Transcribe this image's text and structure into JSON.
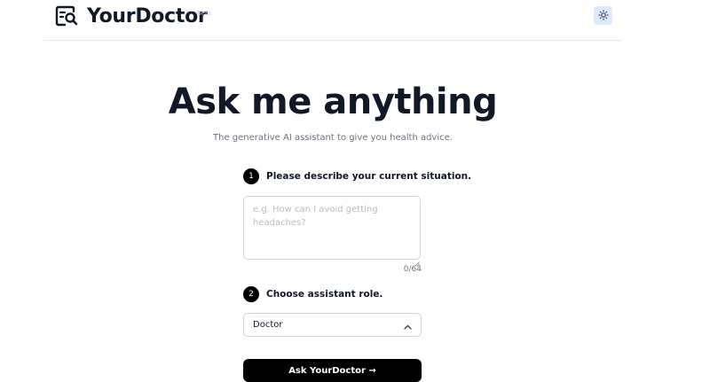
{
  "header": {
    "brand": "YourDoctor",
    "badge": "Beta",
    "logo_icon": "document-search-icon",
    "theme_icon": "sun-icon",
    "theme_button_color": "#dbeafe"
  },
  "hero": {
    "title": "Ask me anything",
    "subtitle": "The generative AI assistant to give you health advice."
  },
  "form": {
    "step1": {
      "number": "1",
      "label": "Please describe your current situation."
    },
    "situation": {
      "value": "",
      "placeholder": "e.g. How can I avoid getting headaches?",
      "counter": "0/64"
    },
    "step2": {
      "number": "2",
      "label": "Choose assistant role."
    },
    "role_select": {
      "selected": "Doctor",
      "icon": "chevron-up-icon"
    },
    "submit_label": "Ask YourDoctor →",
    "submit_color": "#000000"
  }
}
